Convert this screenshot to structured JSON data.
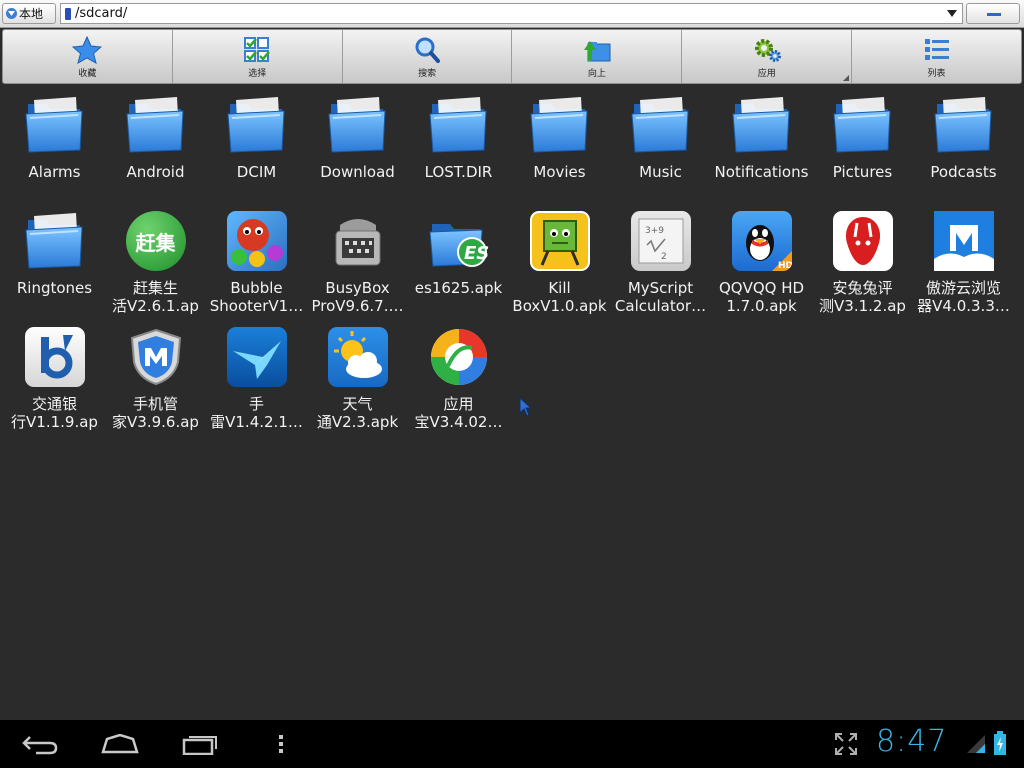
{
  "pathbar": {
    "location_label": "本地",
    "path": "/sdcard/"
  },
  "toolbar": {
    "buttons": [
      {
        "label": "收藏",
        "icon": "star-icon"
      },
      {
        "label": "选择",
        "icon": "select-grid-icon"
      },
      {
        "label": "搜索",
        "icon": "search-icon"
      },
      {
        "label": "向上",
        "icon": "folder-up-icon"
      },
      {
        "label": "应用",
        "icon": "gears-icon"
      },
      {
        "label": "列表",
        "icon": "list-icon"
      }
    ]
  },
  "files": [
    {
      "name": "Alarms",
      "type": "folder"
    },
    {
      "name": "Android",
      "type": "folder"
    },
    {
      "name": "DCIM",
      "type": "folder"
    },
    {
      "name": "Download",
      "type": "folder"
    },
    {
      "name": "LOST.DIR",
      "type": "folder"
    },
    {
      "name": "Movies",
      "type": "folder"
    },
    {
      "name": "Music",
      "type": "folder"
    },
    {
      "name": "Notifications",
      "type": "folder"
    },
    {
      "name": "Pictures",
      "type": "folder"
    },
    {
      "name": "Podcasts",
      "type": "folder"
    },
    {
      "name": "Ringtones",
      "type": "folder"
    },
    {
      "name": "赶集生活V2.6.1.apk",
      "display": "赶集生\n活V2.6.1.ap",
      "type": "apk",
      "icon": "ganji-icon",
      "badge": "赶集"
    },
    {
      "name": "Bubble ShooterV1…",
      "display": "Bubble\nShooterV1…",
      "type": "apk",
      "icon": "bubble-shooter-icon"
    },
    {
      "name": "BusyBox ProV9.6.7…",
      "display": "BusyBox\nProV9.6.7.…",
      "type": "apk",
      "icon": "busybox-icon"
    },
    {
      "name": "es1625.apk",
      "type": "apk-file",
      "icon": "es-folder-icon"
    },
    {
      "name": "Kill BoxV1.0.apk",
      "display": "Kill\nBoxV1.0.apk",
      "type": "apk",
      "icon": "killbox-icon"
    },
    {
      "name": "MyScript Calculator…",
      "display": "MyScript\nCalculator…",
      "type": "apk",
      "icon": "myscript-icon"
    },
    {
      "name": "QQVQQ HD 1.7.0.apk",
      "display": "QQVQQ HD\n1.7.0.apk",
      "type": "apk",
      "icon": "qq-icon"
    },
    {
      "name": "安兔兔评测V3.1.2.apk",
      "display": "安兔兔评\n测V3.1.2.ap",
      "type": "apk",
      "icon": "antutu-icon"
    },
    {
      "name": "傲游云浏览器V4.0.3.3…",
      "display": "傲游云浏览\n器V4.0.3.3…",
      "type": "apk",
      "icon": "maxthon-icon"
    },
    {
      "name": "交通银行V1.1.9.apk",
      "display": "交通银\n行V1.1.9.ap",
      "type": "apk",
      "icon": "bocom-icon"
    },
    {
      "name": "手机管家V3.9.6.apk",
      "display": "手机管\n家V3.9.6.ap",
      "type": "apk",
      "icon": "shield-m-icon"
    },
    {
      "name": "手雷V1.4.2.1…",
      "display": "手\n雷V1.4.2.1…",
      "type": "apk",
      "icon": "xunlei-bird-icon"
    },
    {
      "name": "天气通V2.3.apk",
      "display": "天气\n通V2.3.apk",
      "type": "apk",
      "icon": "weather-icon"
    },
    {
      "name": "应用宝V3.4.02…",
      "display": "应用\n宝V3.4.02…",
      "type": "apk",
      "icon": "yingyongbao-icon"
    }
  ],
  "statusbar": {
    "time": "8:47"
  },
  "colors": {
    "accent": "#33b5e5",
    "background": "#2b2b2b",
    "folder": "#3d8fe0"
  }
}
